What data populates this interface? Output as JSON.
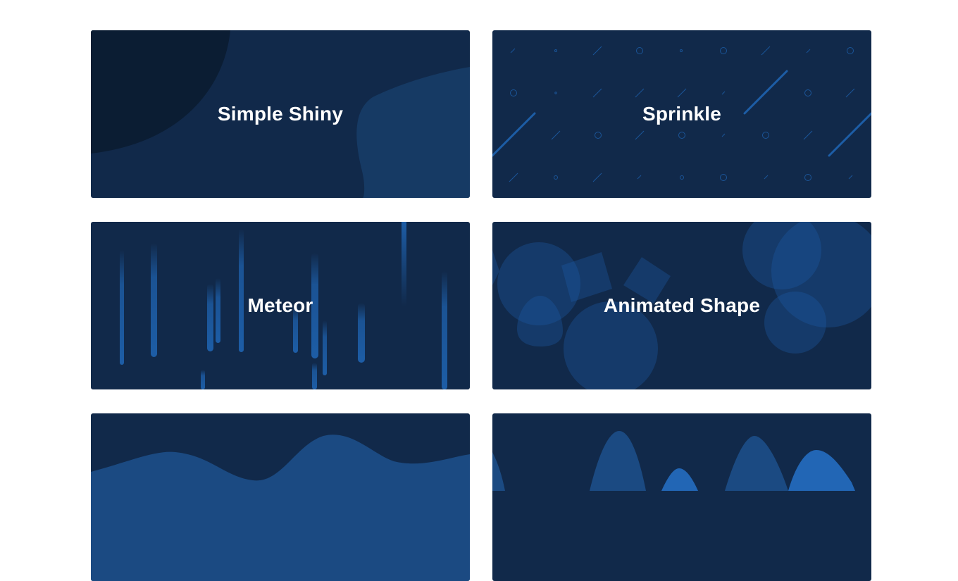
{
  "cards": [
    {
      "title": "Simple Shiny"
    },
    {
      "title": "Sprinkle"
    },
    {
      "title": "Meteor"
    },
    {
      "title": "Animated Shape"
    },
    {
      "title": ""
    },
    {
      "title": ""
    }
  ],
  "colors": {
    "card_background": "#11294a",
    "accent_light": "#1d5da6",
    "accent_mid": "#163a64",
    "accent_dark": "#0b1d33"
  }
}
